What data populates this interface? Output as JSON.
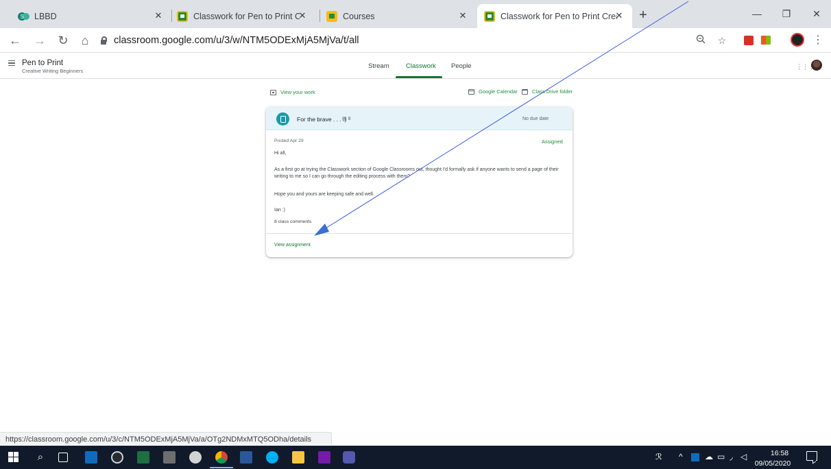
{
  "browser": {
    "tabs": [
      {
        "title": "LBBD",
        "favicon": "lbbd-icon"
      },
      {
        "title": "Classwork for Pen to Print Creativ",
        "favicon": "classroom-icon"
      },
      {
        "title": "Courses",
        "favicon": "classroom-courses-icon"
      },
      {
        "title": "Classwork for Pen to Print Creativ",
        "favicon": "classroom-icon"
      }
    ],
    "active_tab_index": 3,
    "url": "classroom.google.com/u/3/w/NTM5ODExMjA5MjVa/t/all",
    "status_url": "https://classroom.google.com/u/3/c/NTM5ODExMjA5MjVa/a/OTg2NDMxMTQ5ODha/details"
  },
  "classroom": {
    "class_name": "Pen to Print",
    "class_section": "Creative Writing Beginners",
    "nav_tabs": [
      "Stream",
      "Classwork",
      "People"
    ],
    "active_nav_tab": "Classwork",
    "view_your_work": "View your work",
    "google_calendar": "Google Calendar",
    "class_drive_folder": "Class Drive folder",
    "accent_color": "#137333"
  },
  "assignment": {
    "title": "For the brave . . . :)",
    "comment_count": "8",
    "due": "No due date",
    "posted": "Posted Apr 29",
    "status": "Assigned",
    "body": [
      "Hi all,",
      "As a first go at trying the Classwork section of Google Classrooms out, thought I'd formally ask if anyone wants to send a page of their writing to me so I can go through the editing process with them?",
      "Hope you and yours are keeping safe and well.",
      "Ian :)"
    ],
    "class_comments": "8 class comments",
    "view_assignment": "View assignment"
  },
  "taskbar": {
    "time": "16:58",
    "date": "09/05/2020"
  }
}
